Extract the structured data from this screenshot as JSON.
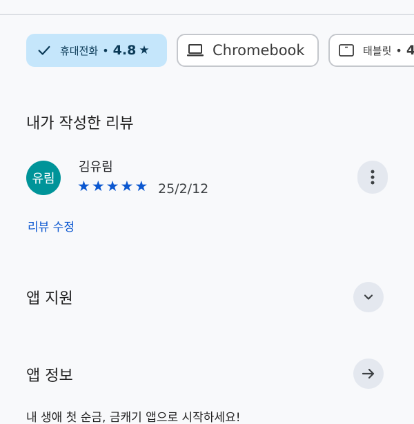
{
  "device_chips": {
    "phone": {
      "label": "휴대전화",
      "rating": "4.8",
      "selected": true,
      "check_icon": "check-icon",
      "star": "★"
    },
    "chromebook": {
      "label": "Chromebook",
      "icon": "laptop-icon"
    },
    "tablet": {
      "label": "태블릿",
      "rating": "4",
      "icon": "tablet-icon"
    }
  },
  "separator": "•",
  "my_review": {
    "title": "내가 작성한 리뷰",
    "avatar_text": "유림",
    "reviewer": "김유림",
    "stars": 5,
    "star_glyph": "★",
    "date": "25/2/12",
    "edit_label": "리뷰 수정"
  },
  "app_support": {
    "title": "앱 지원",
    "icon": "chevron-down-icon"
  },
  "app_info": {
    "title": "앱 정보",
    "icon": "arrow-right-icon"
  },
  "description": "내 생애 첫 순금, 금캐기 앱으로 시작하세요!",
  "colors": {
    "accent": "#0b57d0",
    "chip_selected_bg": "#c5e6fb",
    "avatar_bg": "#009499",
    "button_bg": "#e4e8ef"
  }
}
